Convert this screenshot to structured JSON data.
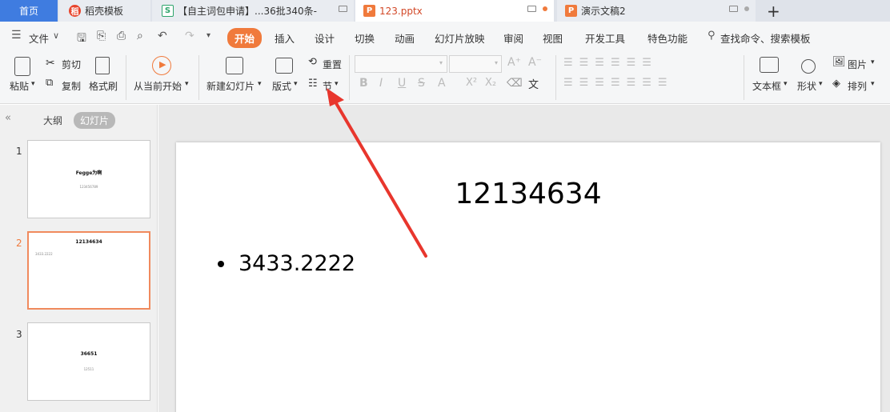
{
  "tabs": {
    "home": "首页",
    "docer": "稻壳模板",
    "sheet": "【自主词包申请】...36批340条-",
    "pptx": "123.pptx",
    "draft": "演示文稿2",
    "new_tab": "+"
  },
  "menu": {
    "file": "文件",
    "items": [
      "开始",
      "插入",
      "设计",
      "切换",
      "动画",
      "幻灯片放映",
      "审阅",
      "视图",
      "开发工具",
      "特色功能"
    ],
    "search": "查找命令、搜索模板"
  },
  "ribbon": {
    "paste": "粘贴",
    "cut": "剪切",
    "copy": "复制",
    "format_painter": "格式刷",
    "from_current": "从当前开始",
    "new_slide": "新建幻灯片",
    "layout": "版式",
    "reset": "重置",
    "section": "节",
    "textbox": "文本框",
    "shape": "形状",
    "picture": "图片",
    "arrange": "排列"
  },
  "left_panel": {
    "outline_tab": "大纲",
    "slides_tab": "幻灯片",
    "slides": [
      {
        "num": "1",
        "title": "Fegge为啊",
        "sub": "123456789"
      },
      {
        "num": "2",
        "title": "12134634",
        "sub": "3433.2222"
      },
      {
        "num": "3",
        "title": "36651",
        "sub": "12511"
      }
    ]
  },
  "slide": {
    "title": "12134634",
    "bullet": "3433.2222"
  },
  "colors": {
    "accent": "#f07a3c",
    "home_tab": "#3f7ce0",
    "arrow": "#e8362d"
  }
}
